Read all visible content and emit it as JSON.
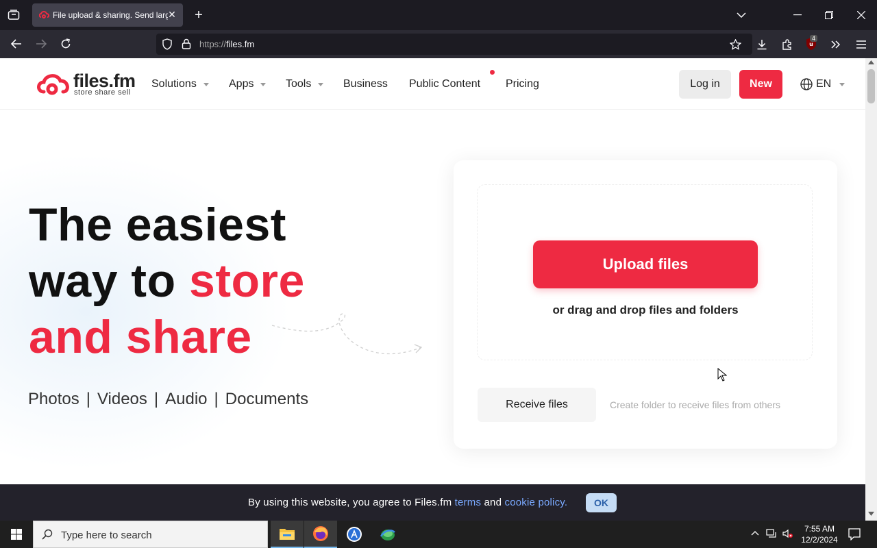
{
  "browser": {
    "tab_title": "File upload & sharing. Send larg",
    "url_scheme": "https://",
    "url_host": "files.fm",
    "extension_badge": "4"
  },
  "header": {
    "logo_text": "files.fm",
    "logo_sub": "store  share  sell",
    "nav": [
      {
        "label": "Solutions"
      },
      {
        "label": "Apps"
      },
      {
        "label": "Tools"
      },
      {
        "label": "Business"
      },
      {
        "label": "Public Content"
      },
      {
        "label": "Pricing"
      }
    ],
    "login_label": "Log in",
    "new_label": "New",
    "lang_label": "EN"
  },
  "hero": {
    "line1": "The easiest",
    "line2_a": "way to ",
    "line2_b": "store",
    "line3": "and share",
    "tags": [
      "Photos",
      "Videos",
      "Audio",
      "Documents"
    ],
    "tag_separator": "|"
  },
  "upload_card": {
    "upload_label": "Upload files",
    "drag_text": "or drag and drop files and folders",
    "receive_label": "Receive files",
    "receive_note": "Create folder to receive files from others"
  },
  "cookie": {
    "text_before": "By using this website, you agree to Files.fm ",
    "terms": "terms",
    "and": " and ",
    "policy": "cookie policy.",
    "ok_label": "OK"
  },
  "taskbar": {
    "search_placeholder": "Type here to search",
    "time": "7:55 AM",
    "date": "12/2/2024"
  },
  "colors": {
    "brand_red": "#ee2a42",
    "browser_dark": "#1c1b22"
  }
}
